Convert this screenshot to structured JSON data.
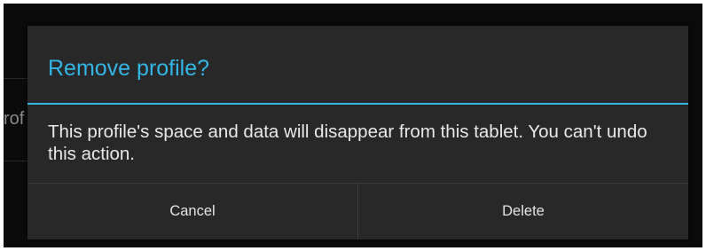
{
  "background": {
    "partial_text": "rof"
  },
  "dialog": {
    "title": "Remove profile?",
    "message": "This profile's space and data will disappear from this tablet. You can't undo this action.",
    "buttons": {
      "cancel_label": "Cancel",
      "delete_label": "Delete"
    },
    "colors": {
      "accent": "#33b5e5",
      "dialog_background": "#282828",
      "screen_background": "#0b0b0b"
    }
  }
}
